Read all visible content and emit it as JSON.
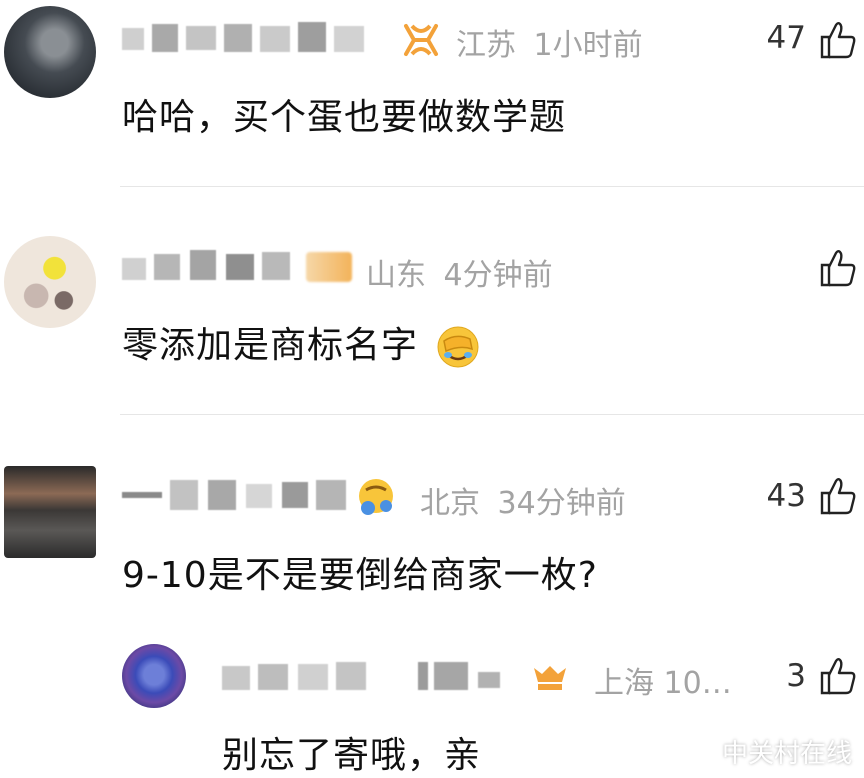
{
  "comments": [
    {
      "location": "江苏",
      "time": "1小时前",
      "likes": "47",
      "text": "哈哈，买个蛋也要做数学题"
    },
    {
      "location": "山东",
      "time": "4分钟前",
      "likes": "",
      "text": "零添加是商标名字"
    },
    {
      "location": "北京",
      "time": "34分钟前",
      "likes": "43",
      "text": "9-10是不是要倒给商家一枚?"
    }
  ],
  "reply": {
    "meta": "上海 10…",
    "likes": "3",
    "text": "别忘了寄哦，亲"
  },
  "watermark": "中关村在线",
  "icons": {
    "like": "thumbs-up-icon",
    "badge": "member-badge-icon",
    "emoji": "facepalm-emoji-icon"
  },
  "colors": {
    "meta": "#a3a3a3",
    "text": "#111111",
    "divider": "#e6e6e6",
    "badge_orange": "#f3a23a"
  }
}
